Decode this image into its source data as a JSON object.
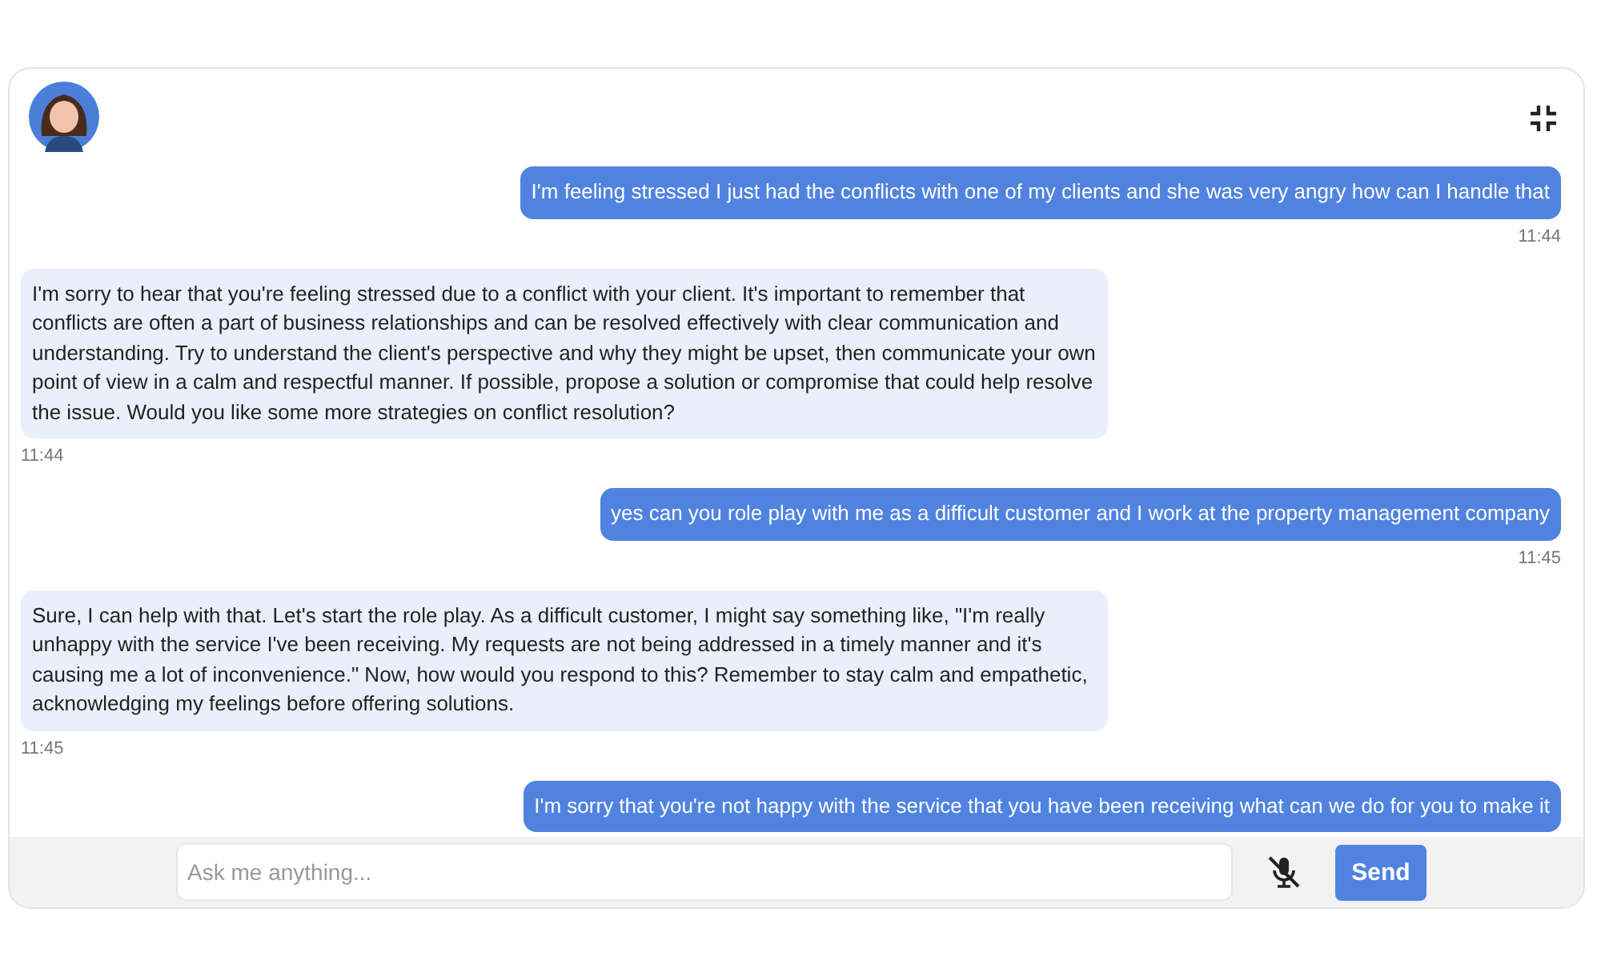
{
  "messages": [
    {
      "kind": "user",
      "text": "I'm feeling stressed I just had the conflicts with one of my clients and she was very angry how can I handle that",
      "time": "11:44"
    },
    {
      "kind": "bot",
      "text": "I'm sorry to hear that you're feeling stressed due to a conflict with your client. It's important to remember that conflicts are often a part of business relationships and can be resolved effectively with clear communication and understanding. Try to understand the client's perspective and why they might be upset, then communicate your own point of view in a calm and respectful manner. If possible, propose a solution or compromise that could help resolve the issue. Would you like some more strategies on conflict resolution?",
      "time": "11:44"
    },
    {
      "kind": "user",
      "text": "yes can you role play with me as a difficult customer and I work at the property management company",
      "time": "11:45"
    },
    {
      "kind": "bot",
      "text": "Sure, I can help with that. Let's start the role play. As a difficult customer, I might say something like, \"I'm really unhappy with the service I've been receiving. My requests are not being addressed in a timely manner and it's causing me a lot of inconvenience.\" Now, how would you respond to this? Remember to stay calm and empathetic, acknowledging my feelings before offering solutions.",
      "time": "11:45"
    },
    {
      "kind": "user",
      "text": "I'm sorry that you're not happy with the service that you have been receiving what can we do for you to make it"
    }
  ],
  "input": {
    "placeholder": "Ask me anything..."
  },
  "mic": {
    "muted": true
  },
  "send_button": "Send"
}
